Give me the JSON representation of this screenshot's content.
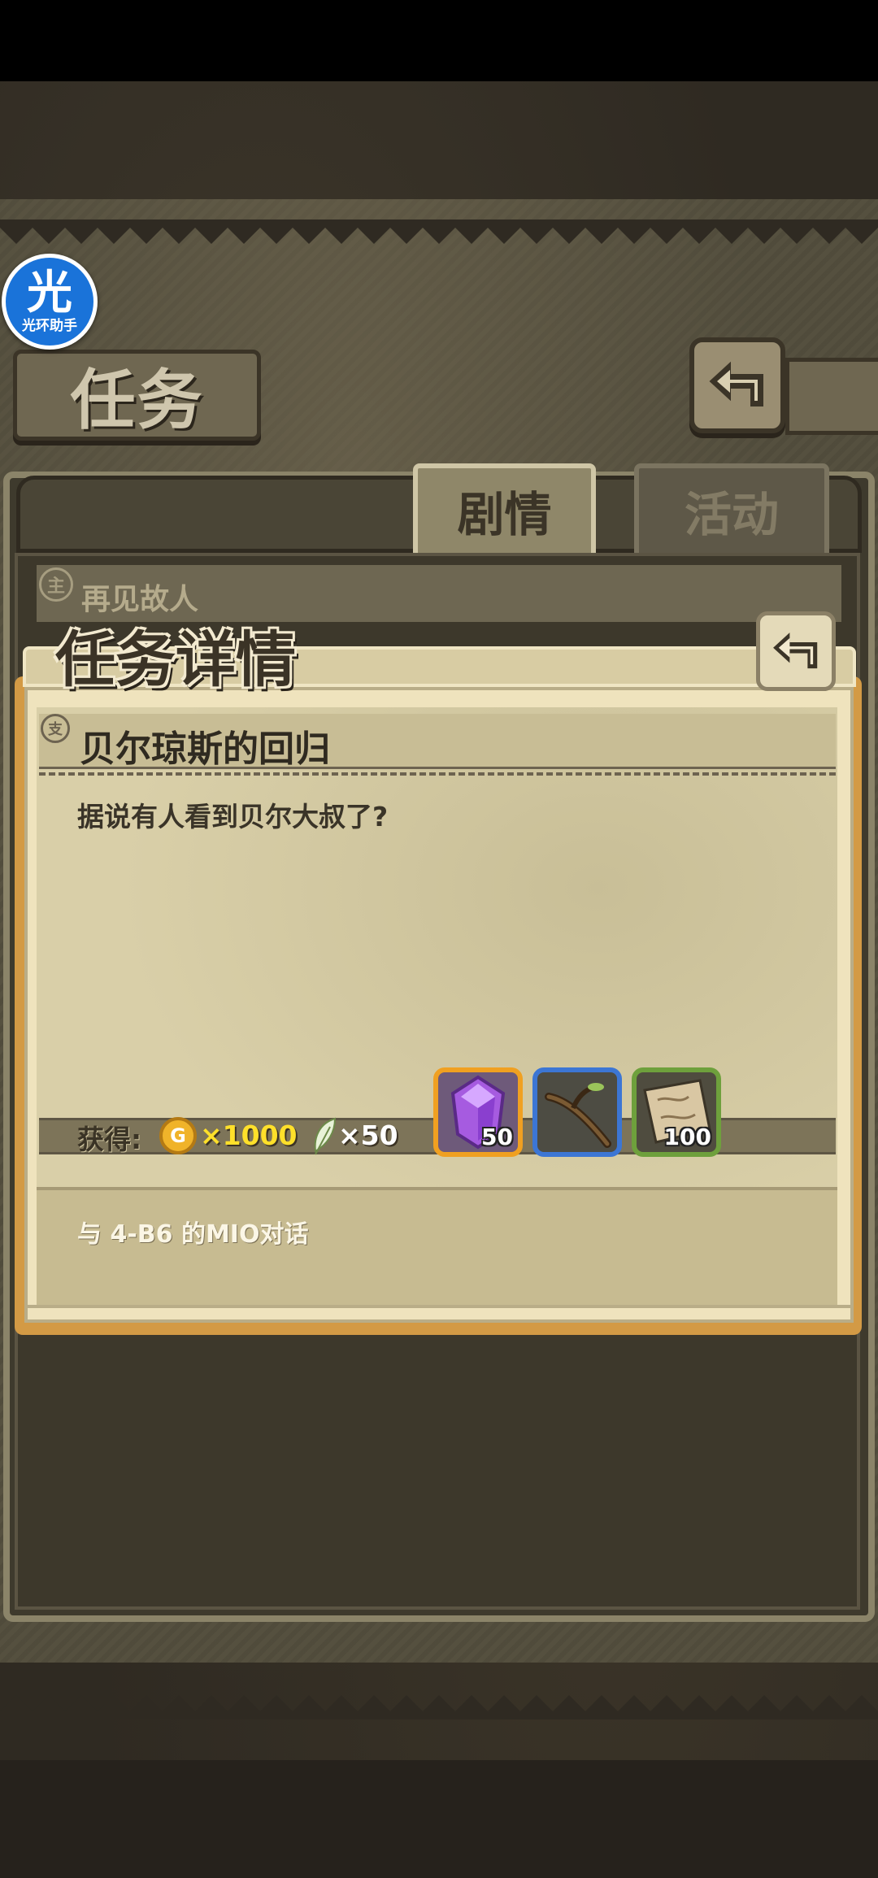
{
  "helper": {
    "big": "光",
    "label": "光环助手"
  },
  "page": {
    "title": "任务"
  },
  "tabs": [
    {
      "label": "剧情"
    },
    {
      "label": "活动"
    }
  ],
  "list": {
    "item_label": "再见故人",
    "item_icon": "主"
  },
  "detail": {
    "title": "任务详情",
    "quest_icon": "支",
    "quest_title": "贝尔琼斯的回归",
    "description": "据说有人看到贝尔大叔了?",
    "reward_label": "获得:",
    "coin_symbol": "G",
    "coin_amount": "×1000",
    "feather_amount": "×50",
    "items": [
      {
        "icon": "purple-crystal",
        "count": "50",
        "frame": "#f0a021"
      },
      {
        "icon": "wooden-branch",
        "count": "",
        "frame": "#3c76d4"
      },
      {
        "icon": "map-scroll",
        "count": "100",
        "frame": "#6ea03c"
      }
    ],
    "objective": "与 4-B6 的MIO对话"
  }
}
